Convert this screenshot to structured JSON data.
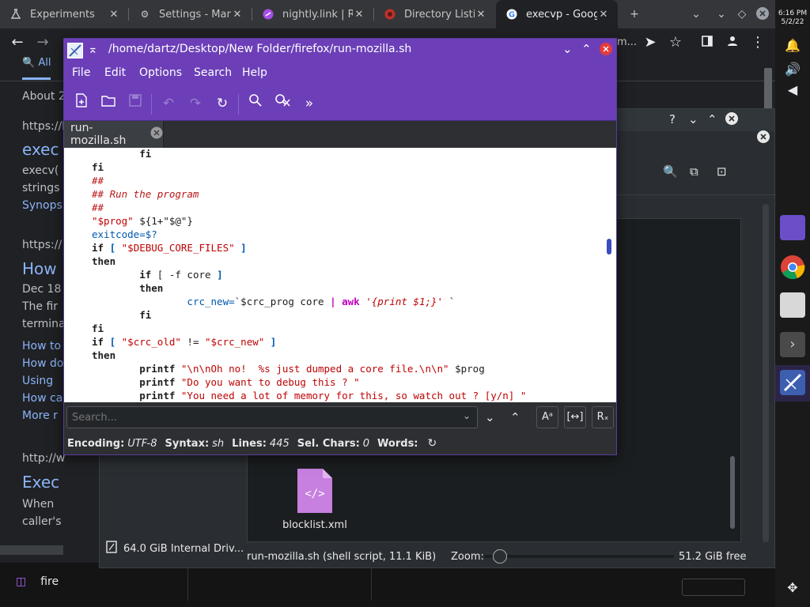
{
  "chrome": {
    "tabs": [
      {
        "label": "Experiments",
        "icon": "flask-icon"
      },
      {
        "label": "Settings - Man",
        "icon": "gear-icon"
      },
      {
        "label": "nightly.link | R",
        "icon": "link-icon"
      },
      {
        "label": "Directory Listin",
        "icon": "firefox-icon"
      },
      {
        "label": "execvp - Googl",
        "icon": "google-icon"
      }
    ],
    "url_fragment": "m..."
  },
  "google": {
    "all_tab": "All",
    "about": "About 2",
    "lines": [
      "https://l",
      "exec",
      "execv(",
      "strings",
      "Synops",
      "https://",
      "How",
      "Dec 18",
      "The fir",
      "termina",
      "How to",
      "How do",
      "Using",
      "How ca",
      "More r",
      "http://w",
      "Exec",
      "When",
      "caller's"
    ]
  },
  "shelf": {
    "time": "6:16 PM",
    "date": "5/2/22"
  },
  "taskbar": {
    "item": "fire"
  },
  "dolphin": {
    "drive": "64.0 GiB Internal Driv...",
    "file": "blocklist.xml",
    "status_file": "run-mozilla.sh (shell script, 11.1 KiB)",
    "zoom_label": "Zoom:",
    "zoom_level": 0.05,
    "free": "51.2 GiB free"
  },
  "kate": {
    "title": "/home/dartz/Desktop/New Folder/firefox/run-mozilla.sh",
    "menu": [
      "File",
      "Edit",
      "Options",
      "Search",
      "Help"
    ],
    "tab": "run-mozilla.sh",
    "search_placeholder": "Search...",
    "status": {
      "encoding_label": "Encoding:",
      "encoding": "UTF-8",
      "syntax_label": "Syntax:",
      "syntax": "sh",
      "lines_label": "Lines:",
      "lines": "445",
      "sel_label": "Sel. Chars:",
      "sel": "0",
      "words_label": "Words:"
    },
    "code": {
      "l01": "fi",
      "l02": "fi",
      "l03": "##",
      "l04": "## Run the program",
      "l05": "##",
      "l06a": "\"$prog\"",
      "l06b": " ${1+\"$@\"}",
      "l07": "exitcode=$?",
      "l08a": "if",
      "l08b": " [ ",
      "l08c": "\"$DEBUG_CORE_FILES\"",
      "l08d": " ]",
      "l09": "then",
      "l10a": "if",
      "l10b": " [ -f core ",
      "l10c": "]",
      "l11": "then",
      "l12a": "crc_new=",
      "l12b": "`$crc_prog core ",
      "l12c": "| ",
      "l12d": "awk",
      "l12e": " '{print $1;}'",
      "l12f": " `",
      "l13": "fi",
      "l14": "fi",
      "l15a": "if",
      "l15b": " [ ",
      "l15c": "\"$crc_old\"",
      "l15d": " != ",
      "l15e": "\"$crc_new\"",
      "l15f": " ]",
      "l16": "then",
      "l17a": "printf",
      "l17b": " \"\\n\\nOh no!  %s just dumped a core file.\\n\\n\"",
      "l17c": " $prog",
      "l18a": "printf",
      "l18b": " \"Do you want to debug this ? \"",
      "l19a": "printf",
      "l19b": " \"You need a lot of memory for this, so watch out ? [y/n] \""
    }
  }
}
